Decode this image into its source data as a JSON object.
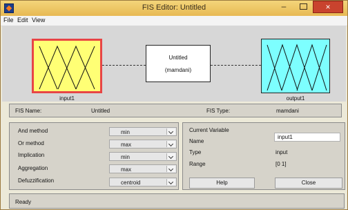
{
  "window": {
    "title": "FIS Editor: Untitled",
    "buttons": {
      "minimize": "–",
      "maximize": "",
      "close": "×"
    }
  },
  "menu": [
    "File",
    "Edit",
    "View"
  ],
  "diagram": {
    "input_label": "input1",
    "rule_title": "Untitled",
    "rule_type": "(mamdani)",
    "output_label": "output1"
  },
  "fis_info": {
    "name_label": "FIS Name:",
    "name_value": "Untitled",
    "type_label": "FIS Type:",
    "type_value": "mamdani"
  },
  "methods": [
    {
      "label": "And method",
      "value": "min"
    },
    {
      "label": "Or method",
      "value": "max"
    },
    {
      "label": "Implication",
      "value": "min"
    },
    {
      "label": "Aggregation",
      "value": "max"
    },
    {
      "label": "Defuzzification",
      "value": "centroid"
    }
  ],
  "current_variable": {
    "header": "Current Variable",
    "name_label": "Name",
    "name_value": "input1",
    "type_label": "Type",
    "type_value": "input",
    "range_label": "Range",
    "range_value": "[0 1]"
  },
  "buttons": {
    "help": "Help",
    "close": "Close"
  },
  "status": "Ready",
  "colors": {
    "input_fill": "#ffff75",
    "input_border": "#e84545",
    "output_fill": "#7dffff",
    "title_bar": "#e7b953",
    "close_button": "#c9432e"
  },
  "icons": [
    "app-icon",
    "minimize-icon",
    "maximize-icon",
    "close-icon",
    "dropdown-arrow-icon"
  ]
}
